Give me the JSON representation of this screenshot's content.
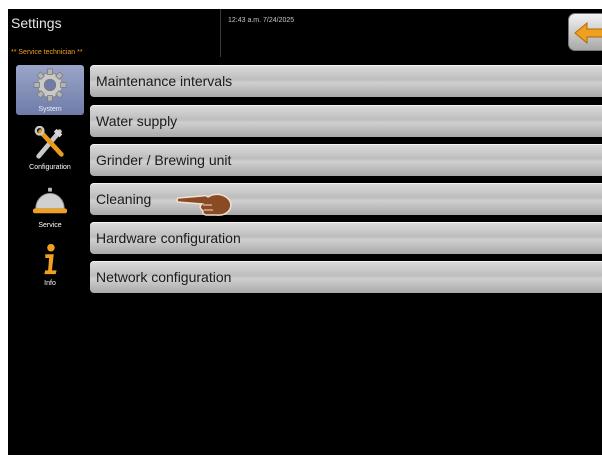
{
  "header": {
    "title": "Settings",
    "role": "** Service technician **",
    "datetime": "12:43 a.m. 7/24/2025",
    "back_icon": "back-arrow-icon"
  },
  "sidebar": {
    "items": [
      {
        "label": "System",
        "icon": "gear-icon",
        "selected": true
      },
      {
        "label": "Configuration",
        "icon": "tools-icon",
        "selected": false
      },
      {
        "label": "Service",
        "icon": "service-bell-icon",
        "selected": false
      },
      {
        "label": "Info",
        "icon": "info-icon",
        "selected": false
      }
    ]
  },
  "menu": {
    "items": [
      {
        "label": "Maintenance intervals"
      },
      {
        "label": "Water supply"
      },
      {
        "label": "Grinder / Brewing unit"
      },
      {
        "label": "Cleaning"
      },
      {
        "label": "Hardware configuration"
      },
      {
        "label": "Network configuration"
      }
    ],
    "pointer_icon": "pointing-hand-icon"
  },
  "colors": {
    "background": "#000000",
    "role_text": "#f0a020",
    "selected_nav": "#7f8bb5",
    "back_arrow": "#f0a020"
  }
}
